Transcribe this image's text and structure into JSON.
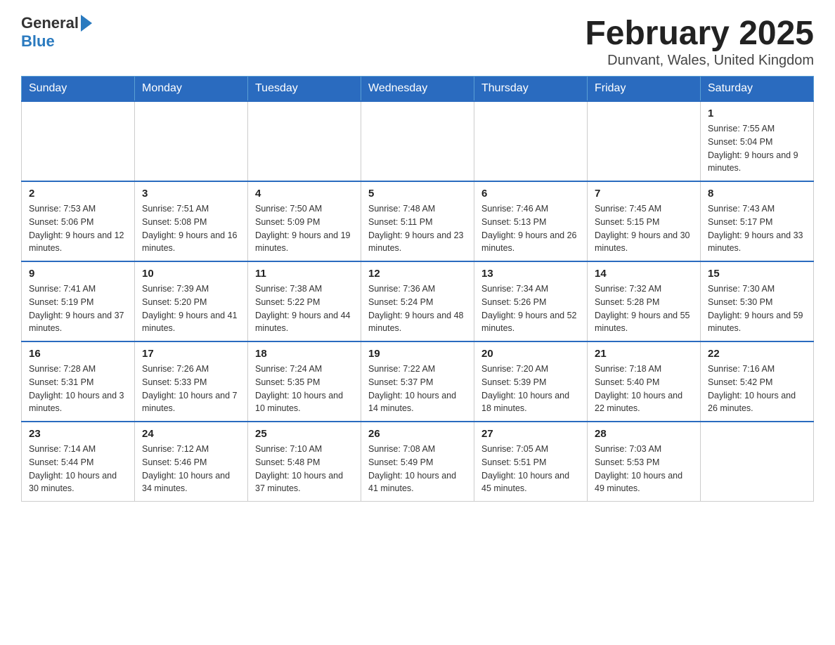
{
  "header": {
    "logo_general": "General",
    "logo_blue": "Blue",
    "month_title": "February 2025",
    "location": "Dunvant, Wales, United Kingdom"
  },
  "weekdays": [
    "Sunday",
    "Monday",
    "Tuesday",
    "Wednesday",
    "Thursday",
    "Friday",
    "Saturday"
  ],
  "weeks": [
    {
      "days": [
        {
          "number": "",
          "info": ""
        },
        {
          "number": "",
          "info": ""
        },
        {
          "number": "",
          "info": ""
        },
        {
          "number": "",
          "info": ""
        },
        {
          "number": "",
          "info": ""
        },
        {
          "number": "",
          "info": ""
        },
        {
          "number": "1",
          "info": "Sunrise: 7:55 AM\nSunset: 5:04 PM\nDaylight: 9 hours and 9 minutes."
        }
      ]
    },
    {
      "days": [
        {
          "number": "2",
          "info": "Sunrise: 7:53 AM\nSunset: 5:06 PM\nDaylight: 9 hours and 12 minutes."
        },
        {
          "number": "3",
          "info": "Sunrise: 7:51 AM\nSunset: 5:08 PM\nDaylight: 9 hours and 16 minutes."
        },
        {
          "number": "4",
          "info": "Sunrise: 7:50 AM\nSunset: 5:09 PM\nDaylight: 9 hours and 19 minutes."
        },
        {
          "number": "5",
          "info": "Sunrise: 7:48 AM\nSunset: 5:11 PM\nDaylight: 9 hours and 23 minutes."
        },
        {
          "number": "6",
          "info": "Sunrise: 7:46 AM\nSunset: 5:13 PM\nDaylight: 9 hours and 26 minutes."
        },
        {
          "number": "7",
          "info": "Sunrise: 7:45 AM\nSunset: 5:15 PM\nDaylight: 9 hours and 30 minutes."
        },
        {
          "number": "8",
          "info": "Sunrise: 7:43 AM\nSunset: 5:17 PM\nDaylight: 9 hours and 33 minutes."
        }
      ]
    },
    {
      "days": [
        {
          "number": "9",
          "info": "Sunrise: 7:41 AM\nSunset: 5:19 PM\nDaylight: 9 hours and 37 minutes."
        },
        {
          "number": "10",
          "info": "Sunrise: 7:39 AM\nSunset: 5:20 PM\nDaylight: 9 hours and 41 minutes."
        },
        {
          "number": "11",
          "info": "Sunrise: 7:38 AM\nSunset: 5:22 PM\nDaylight: 9 hours and 44 minutes."
        },
        {
          "number": "12",
          "info": "Sunrise: 7:36 AM\nSunset: 5:24 PM\nDaylight: 9 hours and 48 minutes."
        },
        {
          "number": "13",
          "info": "Sunrise: 7:34 AM\nSunset: 5:26 PM\nDaylight: 9 hours and 52 minutes."
        },
        {
          "number": "14",
          "info": "Sunrise: 7:32 AM\nSunset: 5:28 PM\nDaylight: 9 hours and 55 minutes."
        },
        {
          "number": "15",
          "info": "Sunrise: 7:30 AM\nSunset: 5:30 PM\nDaylight: 9 hours and 59 minutes."
        }
      ]
    },
    {
      "days": [
        {
          "number": "16",
          "info": "Sunrise: 7:28 AM\nSunset: 5:31 PM\nDaylight: 10 hours and 3 minutes."
        },
        {
          "number": "17",
          "info": "Sunrise: 7:26 AM\nSunset: 5:33 PM\nDaylight: 10 hours and 7 minutes."
        },
        {
          "number": "18",
          "info": "Sunrise: 7:24 AM\nSunset: 5:35 PM\nDaylight: 10 hours and 10 minutes."
        },
        {
          "number": "19",
          "info": "Sunrise: 7:22 AM\nSunset: 5:37 PM\nDaylight: 10 hours and 14 minutes."
        },
        {
          "number": "20",
          "info": "Sunrise: 7:20 AM\nSunset: 5:39 PM\nDaylight: 10 hours and 18 minutes."
        },
        {
          "number": "21",
          "info": "Sunrise: 7:18 AM\nSunset: 5:40 PM\nDaylight: 10 hours and 22 minutes."
        },
        {
          "number": "22",
          "info": "Sunrise: 7:16 AM\nSunset: 5:42 PM\nDaylight: 10 hours and 26 minutes."
        }
      ]
    },
    {
      "days": [
        {
          "number": "23",
          "info": "Sunrise: 7:14 AM\nSunset: 5:44 PM\nDaylight: 10 hours and 30 minutes."
        },
        {
          "number": "24",
          "info": "Sunrise: 7:12 AM\nSunset: 5:46 PM\nDaylight: 10 hours and 34 minutes."
        },
        {
          "number": "25",
          "info": "Sunrise: 7:10 AM\nSunset: 5:48 PM\nDaylight: 10 hours and 37 minutes."
        },
        {
          "number": "26",
          "info": "Sunrise: 7:08 AM\nSunset: 5:49 PM\nDaylight: 10 hours and 41 minutes."
        },
        {
          "number": "27",
          "info": "Sunrise: 7:05 AM\nSunset: 5:51 PM\nDaylight: 10 hours and 45 minutes."
        },
        {
          "number": "28",
          "info": "Sunrise: 7:03 AM\nSunset: 5:53 PM\nDaylight: 10 hours and 49 minutes."
        },
        {
          "number": "",
          "info": ""
        }
      ]
    }
  ]
}
